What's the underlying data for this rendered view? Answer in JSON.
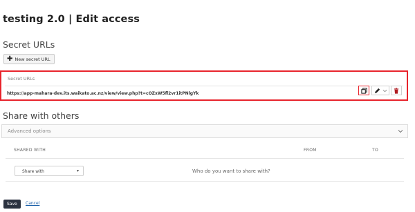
{
  "page": {
    "title": "testing 2.0 | Edit access"
  },
  "secret_urls": {
    "heading": "Secret URLs",
    "new_button_label": "New secret URL",
    "panel_label": "Secret URLs",
    "url": "https://app-mahara-dev.its.waikato.ac.nz/view/view.php?t=cOZxW5fl2vr1itPNlgYk",
    "icons": [
      "plus-icon",
      "copy-icon",
      "pencil-icon",
      "chevron-down-icon",
      "trash-icon"
    ]
  },
  "share": {
    "heading": "Share with others",
    "advanced_label": "Advanced options",
    "columns": [
      "SHARED WITH",
      "FROM",
      "TO"
    ],
    "select_value": "Share with",
    "hint": "Who do you want to share with?"
  },
  "form": {
    "save_label": "Save",
    "cancel_label": "Cancel"
  },
  "colors": {
    "highlight": "#e8232b",
    "save_bg": "#2b3240",
    "link": "#1a5fa8"
  }
}
